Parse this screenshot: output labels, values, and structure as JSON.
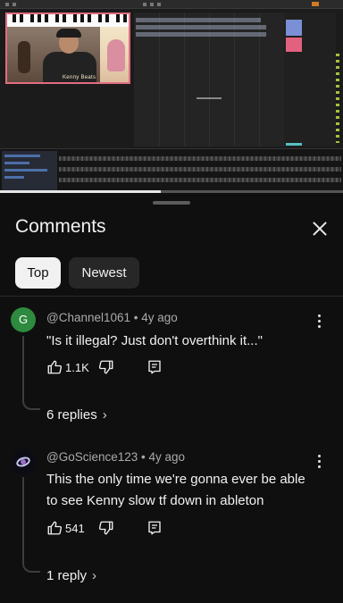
{
  "sheet": {
    "title": "Comments",
    "tabs": [
      {
        "label": "Top",
        "selected": true
      },
      {
        "label": "Newest",
        "selected": false
      }
    ]
  },
  "video": {
    "webcam_caption": "Kenny Beats",
    "progress": 0.47
  },
  "comments": [
    {
      "avatar_letter": "G",
      "avatar_color": "#2d8a3e",
      "author": "@Channel1061",
      "age": "4y ago",
      "meta": "@Channel1061 • 4y ago",
      "text": "\"Is it illegal? Just don't overthink it...\"",
      "likes": "1.1K",
      "replies": "6 replies"
    },
    {
      "avatar_icon": "space-avatar-icon",
      "author": "@GoScience123",
      "age": "4y ago",
      "meta": "@GoScience123 • 4y ago",
      "text": "This the only time we're gonna ever be able to see Kenny slow tf down in ableton",
      "likes": "541",
      "replies": "1 reply"
    }
  ],
  "colors": {
    "background": "#0f0f0f",
    "chip_selected": "#f1f1f1",
    "chip_unselected": "#272727",
    "secondary_text": "#aaaaaa"
  }
}
